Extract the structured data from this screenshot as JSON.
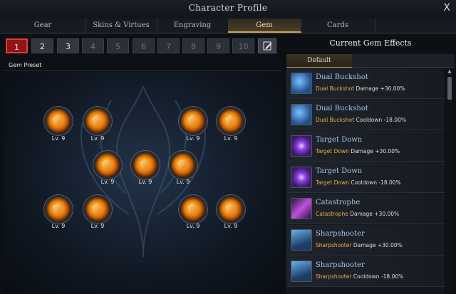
{
  "window": {
    "title": "Character Profile",
    "close_label": "X"
  },
  "tabs": [
    {
      "label": "Gear"
    },
    {
      "label": "Skins & Virtues"
    },
    {
      "label": "Engraving"
    },
    {
      "label": "Gem",
      "active": true
    },
    {
      "label": "Cards"
    }
  ],
  "presets": {
    "buttons": [
      "1",
      "2",
      "3",
      "4",
      "5",
      "6",
      "7",
      "8",
      "9",
      "10"
    ],
    "selected": "1",
    "enabled_count": 3,
    "label": "Gem Preset"
  },
  "gems": [
    {
      "level": "Lv. 9"
    },
    {
      "level": "Lv. 9"
    },
    {
      "level": "Lv. 9"
    },
    {
      "level": "Lv. 9"
    },
    {
      "level": "Lv. 9"
    },
    {
      "level": "Lv. 9"
    },
    {
      "level": "Lv. 9"
    },
    {
      "level": "Lv. 9"
    },
    {
      "level": "Lv. 9"
    },
    {
      "level": "Lv. 9"
    },
    {
      "level": "Lv. 9"
    }
  ],
  "effects_panel": {
    "title": "Current Gem Effects",
    "filter_tab": "Default",
    "items": [
      {
        "name": "Dual Buckshot",
        "skill": "Dual Buckshot",
        "desc": " Damage +30.00%",
        "icon": "dual-buckshot-icon",
        "color": "#2a6fb8"
      },
      {
        "name": "Dual Buckshot",
        "skill": "Dual Buckshot",
        "desc": " Cooldown -18.00%",
        "icon": "dual-buckshot-icon",
        "color": "#2a6fb8"
      },
      {
        "name": "Target Down",
        "skill": "Target Down",
        "desc": " Damage +30.00%",
        "icon": "target-down-icon",
        "color": "#7a3cc8"
      },
      {
        "name": "Target Down",
        "skill": "Target Down",
        "desc": " Cooldown -18.00%",
        "icon": "target-down-icon",
        "color": "#7a3cc8"
      },
      {
        "name": "Catastrophe",
        "skill": "Catastrophe",
        "desc": " Damage +30.00%",
        "icon": "catastrophe-icon",
        "color": "#b042c8"
      },
      {
        "name": "Sharpshooter",
        "skill": "Sharpshooter",
        "desc": " Damage +30.00%",
        "icon": "sharpshooter-icon",
        "color": "#2c6aa6"
      },
      {
        "name": "Sharpshooter",
        "skill": "Sharpshooter",
        "desc": " Cooldown -18.00%",
        "icon": "sharpshooter-icon",
        "color": "#2c6aa6"
      }
    ]
  }
}
